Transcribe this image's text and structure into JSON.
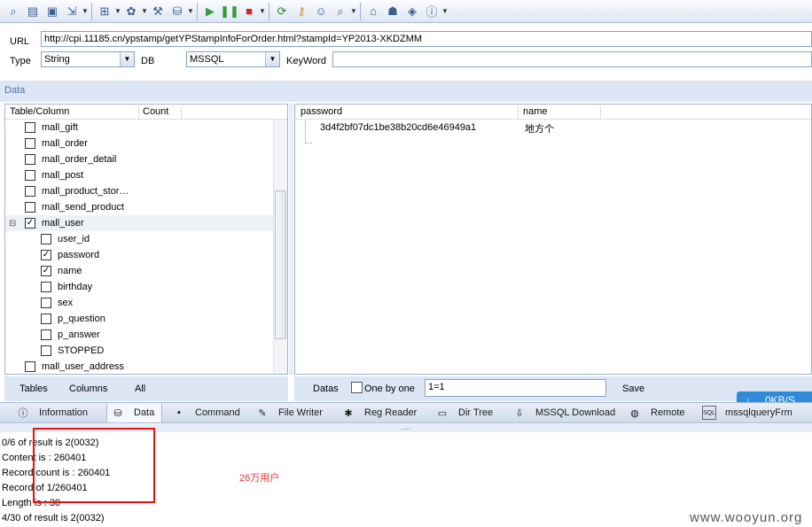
{
  "toolbar": {
    "buttons": [
      "search-icon",
      "folder-icon",
      "save-icon",
      "export-icon",
      "import-icon",
      "settings-icon",
      "wrench-icon",
      "database-icon",
      "play-icon",
      "pause-icon",
      "stop-icon",
      "refresh-icon",
      "key-icon",
      "user-icon",
      "magnifier-icon",
      "home-icon",
      "bug-icon",
      "package-icon",
      "info-icon"
    ],
    "glyphs": {
      "search": "⌕",
      "folder": "▤",
      "save": "▣",
      "export": "⇲",
      "import": "⊞",
      "settings": "✿",
      "wrench": "⚒",
      "database": "⛁",
      "play": "▶",
      "pause": "❚❚",
      "stop": "■",
      "refresh": "⟳",
      "key": "⚷",
      "user": "☺",
      "magnifier": "⌕",
      "home": "⌂",
      "bug": "☗",
      "package": "◈",
      "info": "ⓘ",
      "dropdown": "▼"
    }
  },
  "params": {
    "url_label": "URL",
    "url_value": "http://cpi.11185.cn/ypstamp/getYPStampInfoForOrder.html?stampId=YP2013-XKDZMM",
    "type_label": "Type",
    "type_value": "String",
    "db_label": "DB",
    "db_value": "MSSQL",
    "keyword_label": "KeyWord",
    "keyword_value": ""
  },
  "data_section": {
    "title": "Data"
  },
  "tree": {
    "col_table": "Table/Column",
    "col_count": "Count",
    "rows": [
      {
        "label": "mall_gift",
        "checked": false,
        "level": 0
      },
      {
        "label": "mall_order",
        "checked": false,
        "level": 0
      },
      {
        "label": "mall_order_detail",
        "checked": false,
        "level": 0
      },
      {
        "label": "mall_post",
        "checked": false,
        "level": 0
      },
      {
        "label": "mall_product_stor…",
        "checked": false,
        "level": 0
      },
      {
        "label": "mall_send_product",
        "checked": false,
        "level": 0
      },
      {
        "label": "mall_user",
        "checked": true,
        "level": 0,
        "expanded": true
      },
      {
        "label": "user_id",
        "checked": false,
        "level": 1
      },
      {
        "label": "password",
        "checked": true,
        "level": 1
      },
      {
        "label": "name",
        "checked": true,
        "level": 1
      },
      {
        "label": "birthday",
        "checked": false,
        "level": 1
      },
      {
        "label": "sex",
        "checked": false,
        "level": 1
      },
      {
        "label": "p_question",
        "checked": false,
        "level": 1
      },
      {
        "label": "p_answer",
        "checked": false,
        "level": 1
      },
      {
        "label": "STOPPED",
        "checked": false,
        "level": 1
      },
      {
        "label": "mall_user_address",
        "checked": false,
        "level": 0
      }
    ],
    "check_mark": "✓",
    "collapse_glyph": "⊟"
  },
  "left_footer": {
    "tables": "Tables",
    "columns": "Columns",
    "all": "All"
  },
  "result": {
    "columns": [
      "password",
      "name"
    ],
    "rows": [
      [
        "3d4f2bf07dc1be38b20cd6e46949a1",
        "地方个"
      ]
    ]
  },
  "right_footer": {
    "datas": "Datas",
    "one_by_one": "One by one",
    "filter_value": "1=1",
    "save": "Save"
  },
  "speed": {
    "value": "0KB/S",
    "icon": "↓"
  },
  "tabs": [
    {
      "label": "Information",
      "icon": "information-icon",
      "glyph": "ⓘ"
    },
    {
      "label": "Data",
      "icon": "database-icon",
      "glyph": "⛁",
      "active": true
    },
    {
      "label": "Command",
      "icon": "terminal-icon",
      "glyph": "▪"
    },
    {
      "label": "File Writer",
      "icon": "pencil-icon",
      "glyph": "✎"
    },
    {
      "label": "Reg Reader",
      "icon": "registry-icon",
      "glyph": "✱"
    },
    {
      "label": "Dir Tree",
      "icon": "folder-icon",
      "glyph": "▭"
    },
    {
      "label": "MSSQL Download",
      "icon": "download-icon",
      "glyph": "⇩"
    },
    {
      "label": "Remote",
      "icon": "globe-icon",
      "glyph": "◍"
    },
    {
      "label": "mssqlqueryFrm",
      "icon": "sql-icon",
      "glyph": "SQL"
    }
  ],
  "grip": "....",
  "log": [
    "0/6 of result is 2(0032)",
    "Content is : 260401",
    "Record count is : 260401",
    "Record of 1/260401",
    "Length is : 30",
    "4/30 of result is 2(0032)"
  ],
  "annotation": "26万用户",
  "watermark": "www.wooyun.org",
  "colors": {
    "panel": "#dce6f4",
    "border": "#9fb2cf",
    "highlight_box": "#e11",
    "accent": "#2f8bd9"
  }
}
